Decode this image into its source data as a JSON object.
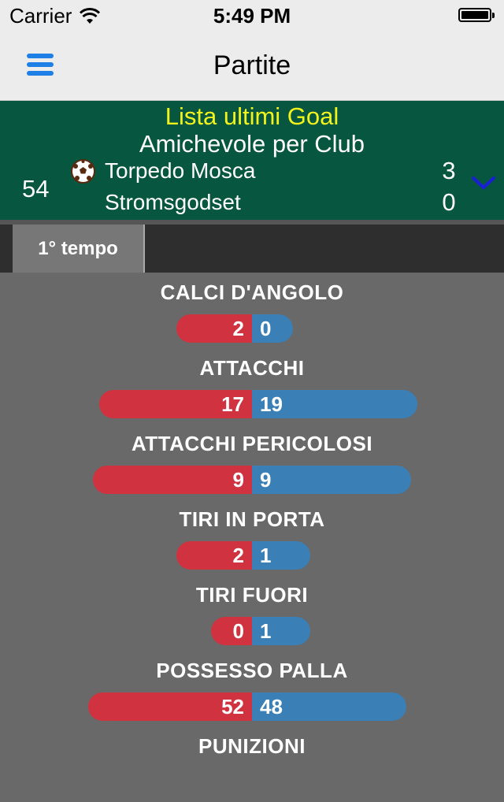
{
  "status_bar": {
    "carrier": "Carrier",
    "time": "5:49 PM",
    "battery_level": 1.0
  },
  "nav": {
    "title": "Partite",
    "menu_icon": "hamburger-icon"
  },
  "match": {
    "goal_list_title": "Lista ultimi Goal",
    "competition": "Amichevole per Club",
    "minute": "54",
    "home_team": "Torpedo Mosca",
    "away_team": "Stromsgodset",
    "home_score": "3",
    "away_score": "0",
    "goal_icon": "soccer-ball-icon",
    "expand_icon": "chevron-down-icon"
  },
  "tabs": [
    {
      "label": "1° tempo"
    }
  ],
  "stats": [
    {
      "label": "CALCI D'ANGOLO",
      "home": "2",
      "away": "0"
    },
    {
      "label": "ATTACCHI",
      "home": "17",
      "away": "19"
    },
    {
      "label": "ATTACCHI PERICOLOSI",
      "home": "9",
      "away": "9"
    },
    {
      "label": "TIRI IN PORTA",
      "home": "2",
      "away": "1"
    },
    {
      "label": "TIRI FUORI",
      "home": "0",
      "away": "1"
    },
    {
      "label": "POSSESSO PALLA",
      "home": "52",
      "away": "48"
    },
    {
      "label": "PUNIZIONI",
      "home": "",
      "away": ""
    }
  ],
  "colors": {
    "home_bar": "#d0323f",
    "away_bar": "#3a7fb6",
    "header_bg": "#07563f",
    "goal_title": "#f2f21d",
    "accent_blue": "#1e7fe6"
  }
}
